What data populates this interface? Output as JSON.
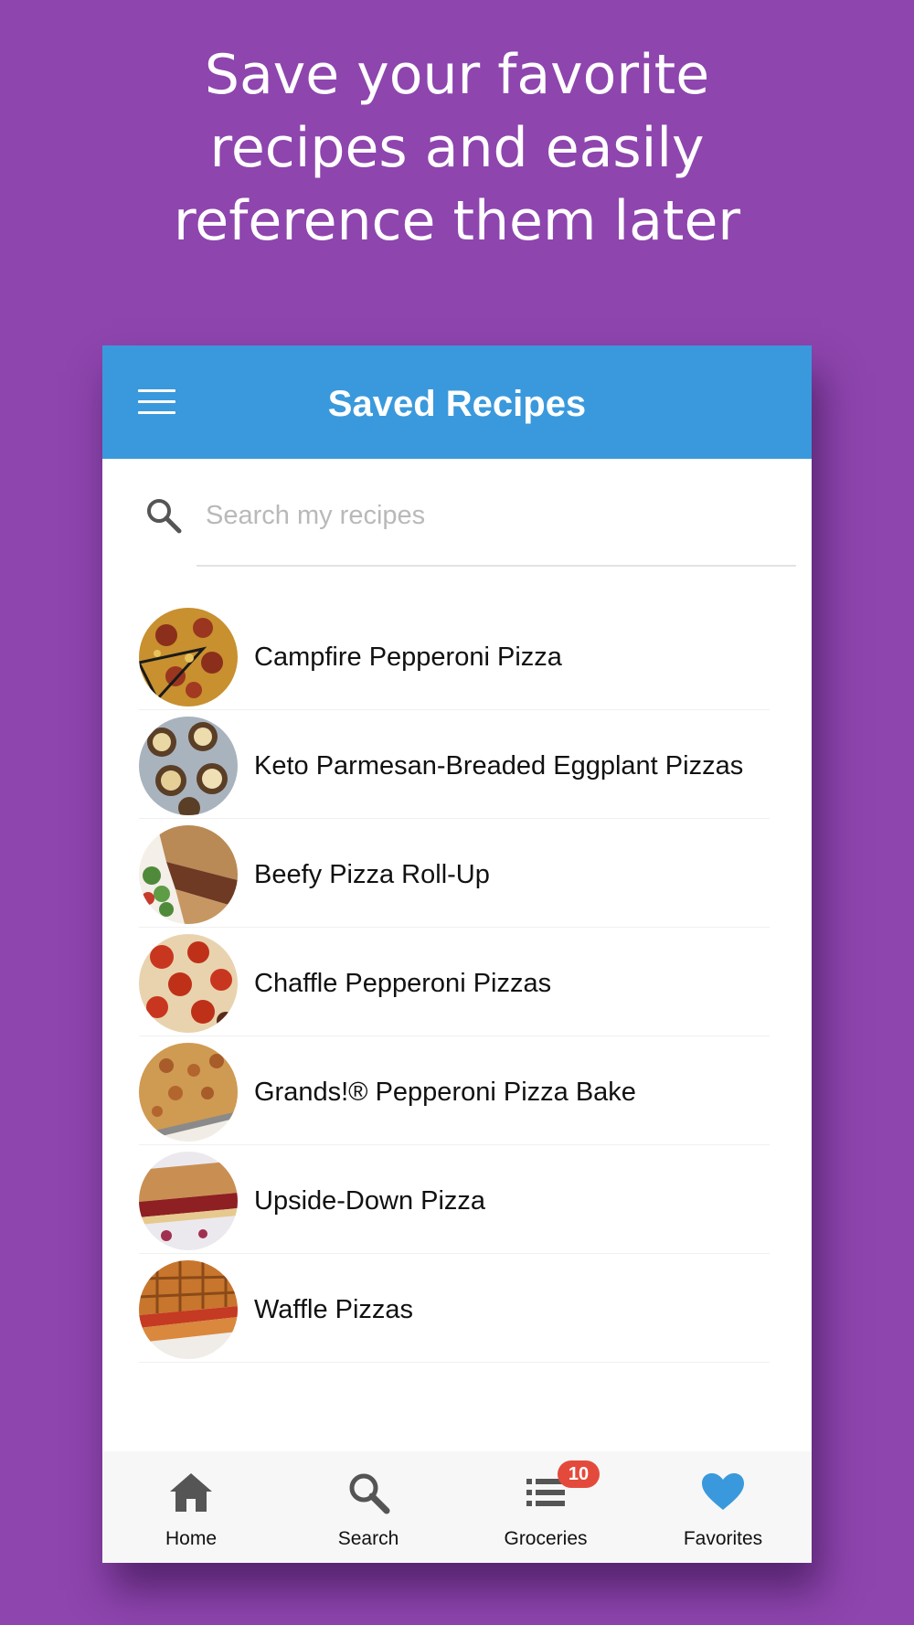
{
  "headline": "Save your favorite recipes and easily reference them later",
  "app_bar": {
    "title": "Saved Recipes",
    "menu_icon": "hamburger-menu-icon",
    "color": "#3a99dc"
  },
  "search": {
    "placeholder": "Search my recipes",
    "value": "",
    "icon": "search-icon"
  },
  "recipes": [
    {
      "name": "Campfire Pepperoni Pizza"
    },
    {
      "name": "Keto Parmesan-Breaded Eggplant Pizzas"
    },
    {
      "name": "Beefy Pizza Roll-Up"
    },
    {
      "name": "Chaffle Pepperoni Pizzas"
    },
    {
      "name": "Grands!® Pepperoni Pizza Bake"
    },
    {
      "name": "Upside-Down Pizza"
    },
    {
      "name": "Waffle Pizzas"
    }
  ],
  "bottom_nav": {
    "items": [
      {
        "label": "Home",
        "icon": "home-icon",
        "active": false
      },
      {
        "label": "Search",
        "icon": "search-icon",
        "active": false
      },
      {
        "label": "Groceries",
        "icon": "list-icon",
        "active": false,
        "badge": "10"
      },
      {
        "label": "Favorites",
        "icon": "heart-icon",
        "active": true
      }
    ]
  },
  "colors": {
    "background": "#8e45ae",
    "accent": "#3a99dc",
    "badge": "#e44a3c",
    "nav_icon": "#555555"
  }
}
